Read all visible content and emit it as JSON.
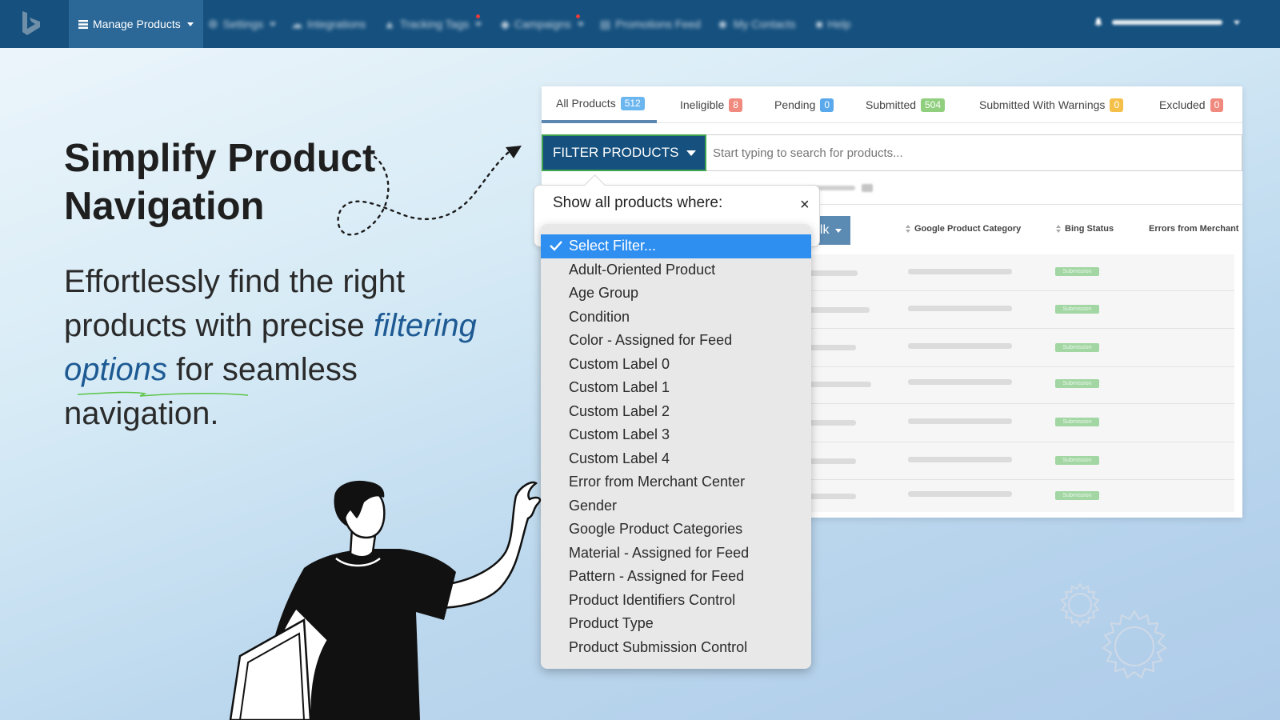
{
  "nav": {
    "items": [
      {
        "label": "Manage Products",
        "icon": "list-icon"
      },
      {
        "label": "Settings",
        "icon": "gear-icon"
      },
      {
        "label": "Integrations",
        "icon": "cloud-icon"
      },
      {
        "label": "Tracking Tags",
        "icon": "chart-icon"
      },
      {
        "label": "Campaigns",
        "icon": "tag-icon"
      },
      {
        "label": "Promotions Feed",
        "icon": "document-icon"
      },
      {
        "label": "My Contacts",
        "icon": "users-icon"
      },
      {
        "label": "Help",
        "icon": "chat-icon"
      }
    ],
    "colors": {
      "bar": "#15507e",
      "active": "#2b6797"
    }
  },
  "hero": {
    "title": "Simplify Product Navigation",
    "body_before": "Effortlessly find the right products with precise",
    "body_highlight": "filtering options",
    "body_after": "for seamless navigation."
  },
  "tabs": [
    {
      "label": "All Products",
      "count": "512",
      "color": "#6cb6f0"
    },
    {
      "label": "Ineligible",
      "count": "8",
      "color": "#f08a7e"
    },
    {
      "label": "Pending",
      "count": "0",
      "color": "#5aa9ec"
    },
    {
      "label": "Submitted",
      "count": "504",
      "color": "#8fcf7e"
    },
    {
      "label": "Submitted With Warnings",
      "count": "0",
      "color": "#f5c04a"
    },
    {
      "label": "Excluded",
      "count": "0",
      "color": "#f08a7e"
    }
  ],
  "filter": {
    "button_label": "FILTER PRODUCTS",
    "search_placeholder": "Start typing to search for products...",
    "popover_title": "Show all products where:",
    "close_symbol": "×",
    "options": [
      "Select Filter...",
      "Adult-Oriented Product",
      "Age Group",
      "Condition",
      "Color - Assigned for Feed",
      "Custom Label 0",
      "Custom Label 1",
      "Custom Label 2",
      "Custom Label 3",
      "Custom Label 4",
      "Error from Merchant Center",
      "Gender",
      "Google Product Categories",
      "Material - Assigned for Feed",
      "Pattern - Assigned for Feed",
      "Product Identifiers Control",
      "Product Type",
      "Product Submission Control"
    ],
    "selected": "Select Filter..."
  },
  "table": {
    "bulk_label": "ulk",
    "columns": [
      "Google Product Category",
      "Bing Status",
      "Errors from Merchant"
    ],
    "status_tag": "Submission"
  }
}
